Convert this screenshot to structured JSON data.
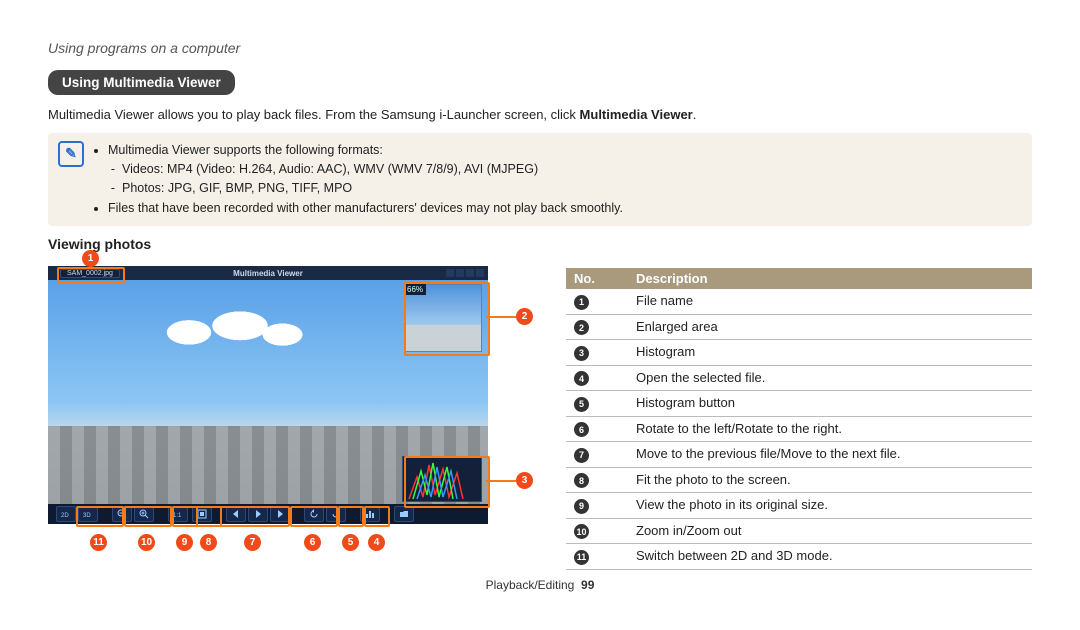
{
  "breadcrumb": "Using programs on a computer",
  "section_pill": "Using Multimedia Viewer",
  "intro_pre": "Multimedia Viewer allows you to play back files. From the Samsung i-Launcher screen, click ",
  "intro_bold": "Multimedia Viewer",
  "intro_post": ".",
  "note": {
    "l1": "Multimedia Viewer supports the following formats:",
    "l1a": "Videos: MP4 (Video: H.264, Audio: AAC), WMV (WMV 7/8/9), AVI (MJPEG)",
    "l1b": "Photos: JPG, GIF, BMP, PNG, TIFF, MPO",
    "l2": "Files that have been recorded with other manufacturers' devices may not play back smoothly."
  },
  "sub_heading": "Viewing photos",
  "viewer": {
    "title": "Multimedia Viewer",
    "filename": "SAM_0002.jpg",
    "thumb_pct": "66%"
  },
  "table": {
    "head_no": "No.",
    "head_desc": "Description",
    "rows": [
      {
        "n": "1",
        "d": "File name"
      },
      {
        "n": "2",
        "d": "Enlarged area"
      },
      {
        "n": "3",
        "d": "Histogram"
      },
      {
        "n": "4",
        "d": "Open the selected file."
      },
      {
        "n": "5",
        "d": "Histogram button"
      },
      {
        "n": "6",
        "d": "Rotate to the left/Rotate to the right."
      },
      {
        "n": "7",
        "d": "Move to the previous file/Move to the next file."
      },
      {
        "n": "8",
        "d": "Fit the photo to the screen."
      },
      {
        "n": "9",
        "d": "View the photo in its original size."
      },
      {
        "n": "10",
        "d": "Zoom in/Zoom out"
      },
      {
        "n": "11",
        "d": "Switch between 2D and 3D mode."
      }
    ]
  },
  "footer_label": "Playback/Editing",
  "footer_page": "99"
}
